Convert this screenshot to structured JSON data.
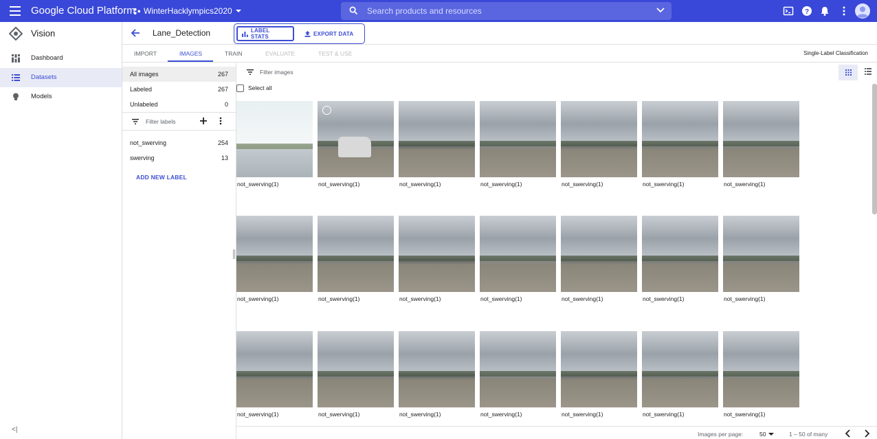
{
  "topbar": {
    "brand": "Google Cloud Platform",
    "project": "WinterHacklympics2020",
    "search_placeholder": "Search products and resources",
    "icons": [
      "menu-icon",
      "project-icon",
      "search-icon",
      "chevron-down-icon",
      "cloud-shell-icon",
      "help-icon",
      "notifications-icon",
      "more-vert-icon",
      "account-icon"
    ]
  },
  "sidebar": {
    "product": "Vision",
    "items": [
      {
        "label": "Dashboard",
        "icon": "dashboard-icon"
      },
      {
        "label": "Datasets",
        "icon": "list-icon",
        "active": true
      },
      {
        "label": "Models",
        "icon": "lightbulb-icon"
      }
    ],
    "collapse_label": "<|"
  },
  "header": {
    "dataset_name": "Lane_Detection",
    "label_stats": "LABEL STATS",
    "export_data": "EXPORT DATA"
  },
  "tabs": {
    "items": [
      {
        "label": "IMPORT",
        "state": "normal"
      },
      {
        "label": "IMAGES",
        "state": "active"
      },
      {
        "label": "TRAIN",
        "state": "normal"
      },
      {
        "label": "EVALUATE",
        "state": "disabled"
      },
      {
        "label": "TEST & USE",
        "state": "disabled"
      }
    ],
    "mode": "Single-Label Classification"
  },
  "labelpanel": {
    "filters": [
      {
        "label": "All images",
        "count": "267"
      },
      {
        "label": "Labeled",
        "count": "267"
      },
      {
        "label": "Unlabeled",
        "count": "0"
      }
    ],
    "filter_placeholder": "Filter labels",
    "labels": [
      {
        "label": "not_swerving",
        "count": "254"
      },
      {
        "label": "swerving",
        "count": "13"
      }
    ],
    "add_label": "ADD NEW LABEL"
  },
  "imagegrid": {
    "filter_placeholder": "Filter images",
    "select_all": "Select all",
    "images": [
      {
        "caption": "not_swerving(1)"
      },
      {
        "caption": "not_swerving(1)"
      },
      {
        "caption": "not_swerving(1)"
      },
      {
        "caption": "not_swerving(1)"
      },
      {
        "caption": "not_swerving(1)"
      },
      {
        "caption": "not_swerving(1)"
      },
      {
        "caption": "not_swerving(1)"
      },
      {
        "caption": "not_swerving(1)"
      },
      {
        "caption": "not_swerving(1)"
      },
      {
        "caption": "not_swerving(1)"
      },
      {
        "caption": "not_swerving(1)"
      },
      {
        "caption": "not_swerving(1)"
      },
      {
        "caption": "not_swerving(1)"
      },
      {
        "caption": "not_swerving(1)"
      },
      {
        "caption": "not_swerving(1)"
      },
      {
        "caption": "not_swerving(1)"
      },
      {
        "caption": "not_swerving(1)"
      },
      {
        "caption": "not_swerving(1)"
      },
      {
        "caption": "not_swerving(1)"
      },
      {
        "caption": "not_swerving(1)"
      },
      {
        "caption": "not_swerving(1)"
      }
    ]
  },
  "footer": {
    "per_page_label": "Images per page:",
    "per_page_value": "50",
    "range": "1 – 50 of many"
  },
  "colors": {
    "topbar": "#3948d8",
    "accent": "#3c4dd4",
    "active_bg": "#e8eaf6"
  }
}
